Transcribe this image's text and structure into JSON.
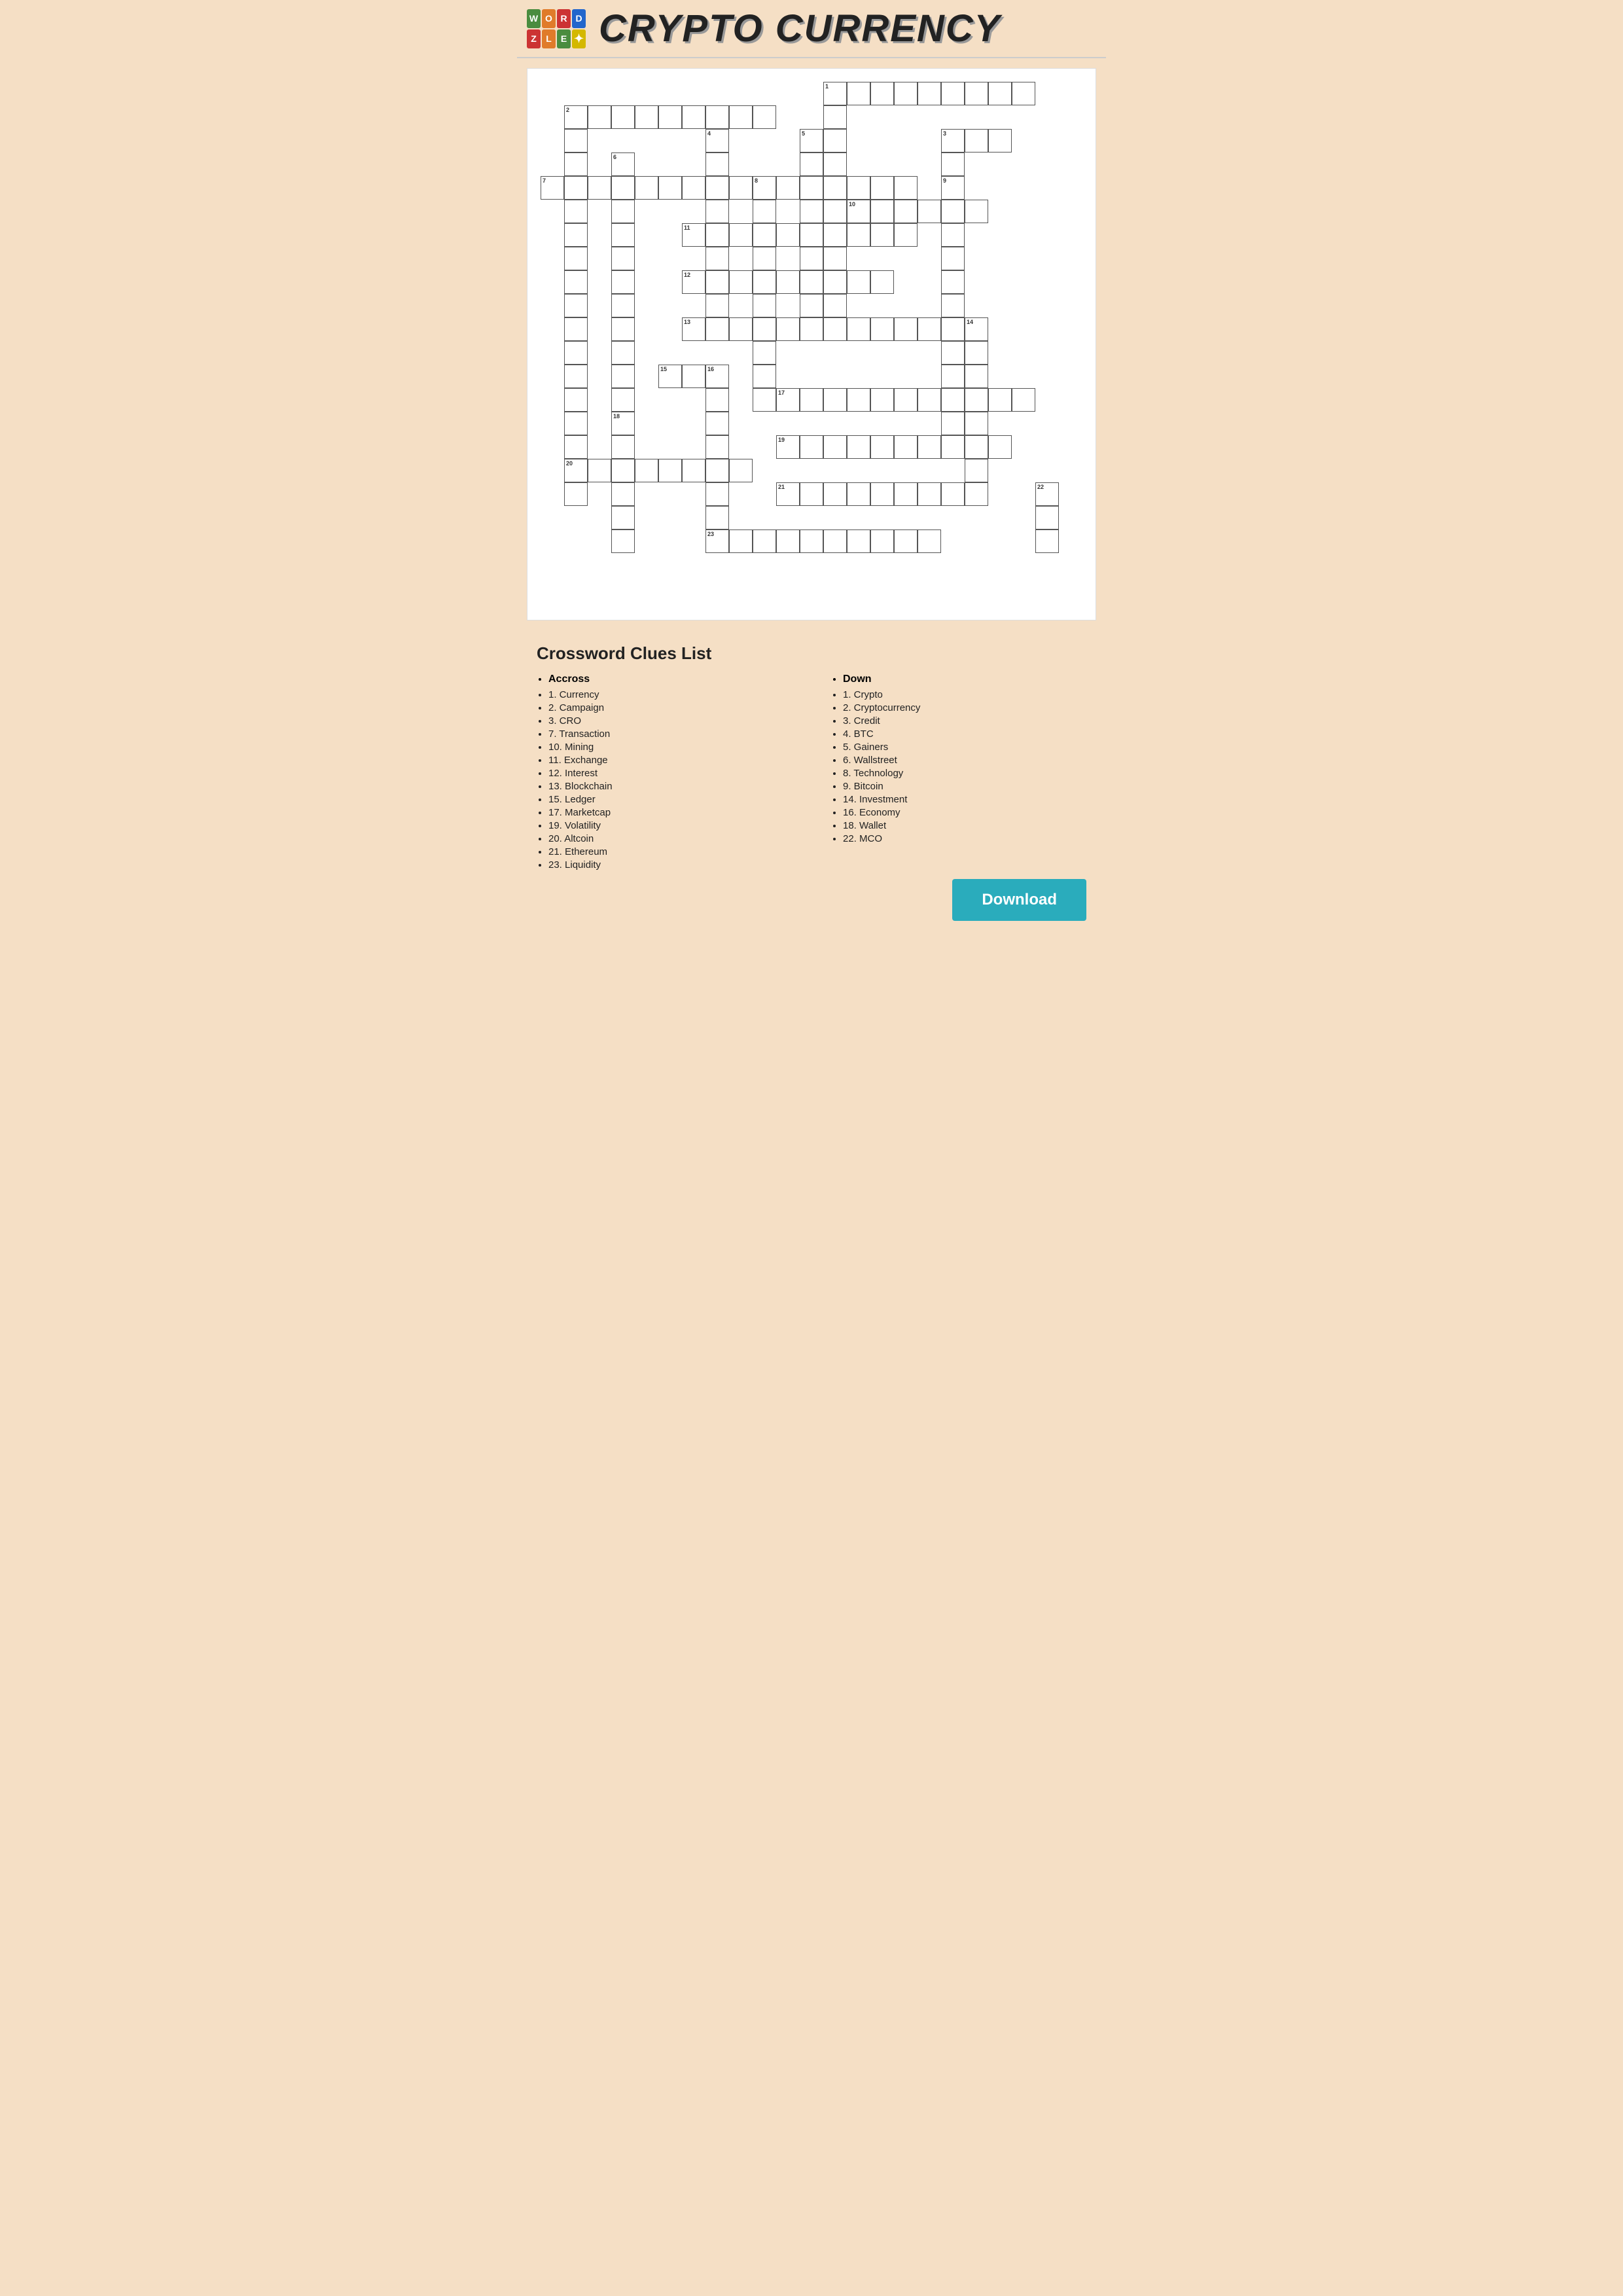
{
  "header": {
    "title": "CRYPTO CURRENCY",
    "logo": {
      "cells": [
        {
          "letter": "W",
          "color": "logo-green"
        },
        {
          "letter": "O",
          "color": "logo-orange"
        },
        {
          "letter": "R",
          "color": "logo-red"
        },
        {
          "letter": "D",
          "color": "logo-blue"
        },
        {
          "letter": "Z",
          "color": "logo-red"
        },
        {
          "letter": "L",
          "color": "logo-orange"
        },
        {
          "letter": "E",
          "color": "logo-green"
        },
        {
          "letter": "✦",
          "color": "logo-yellow"
        }
      ]
    }
  },
  "clues": {
    "title": "Crossword Clues List",
    "across_heading": "Accross",
    "across": [
      "1. Currency",
      "2. Campaign",
      "3. CRO",
      "7. Transaction",
      "10. Mining",
      "11. Exchange",
      "12. Interest",
      "13. Blockchain",
      "15. Ledger",
      "17. Marketcap",
      "19. Volatility",
      "20. Altcoin",
      "21. Ethereum",
      "23. Liquidity"
    ],
    "down_heading": "Down",
    "down": [
      "1. Crypto",
      "2. Cryptocurrency",
      "3. Credit",
      "4. BTC",
      "5. Gainers",
      "6. Wallstreet",
      "8. Technology",
      "9. Bitcoin",
      "14. Investment",
      "16. Economy",
      "18. Wallet",
      "22. MCO"
    ]
  },
  "download_label": "Download"
}
